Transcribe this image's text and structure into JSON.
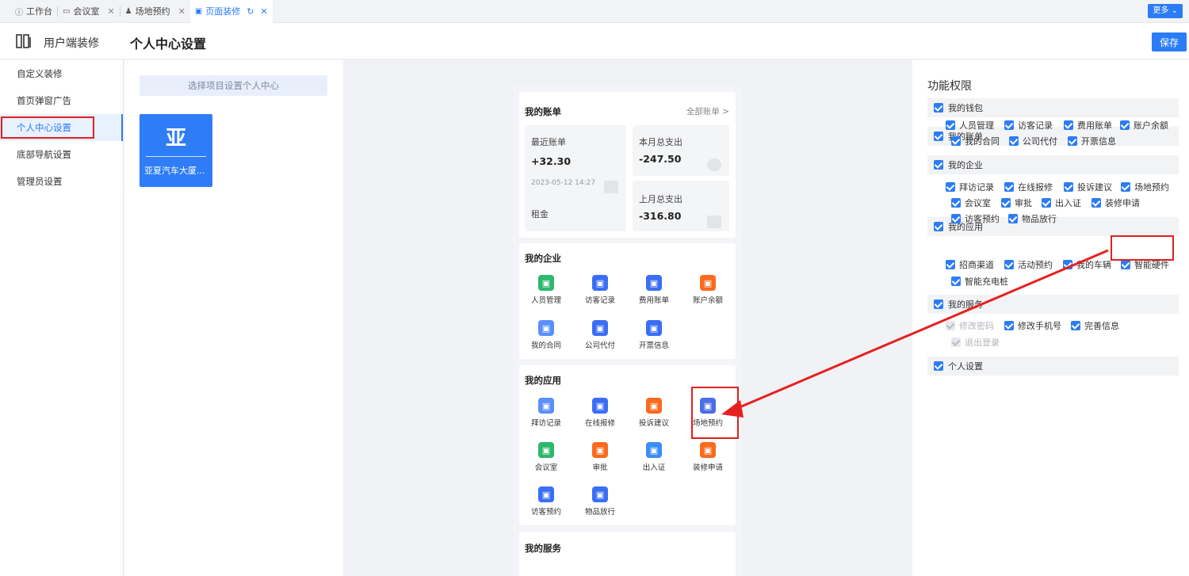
{
  "tabs": [
    {
      "label": "工作台",
      "icon": "info-circle-icon",
      "closable": false
    },
    {
      "label": "会议室",
      "icon": "monitor-icon",
      "closable": true
    },
    {
      "label": "场地预约",
      "icon": "user-icon",
      "closable": true
    },
    {
      "label": "页面装修",
      "icon": "page-icon",
      "closable": true,
      "active": true
    }
  ],
  "more_label": "更多",
  "header": {
    "app_title": "用户端装修",
    "page_title": "个人中心设置",
    "save_label": "保存"
  },
  "sidebar": {
    "items": [
      {
        "label": "自定义装修"
      },
      {
        "label": "首页弹窗广告"
      },
      {
        "label": "个人中心设置",
        "active": true
      },
      {
        "label": "底部导航设置"
      },
      {
        "label": "管理员设置"
      }
    ]
  },
  "project": {
    "placeholder": "选择项目设置个人中心",
    "card_char": "亚",
    "card_name": "亚夏汽车大厦..."
  },
  "preview": {
    "bill": {
      "title": "我的账单",
      "all_label": "全部账单 >",
      "recent_label": "最近账单",
      "recent_amount": "+32.30",
      "recent_date": "2023-05-12 14:27",
      "recent_type": "租金",
      "month_label": "本月总支出",
      "month_amount": "-247.50",
      "last_month_label": "上月总支出",
      "last_month_amount": "-316.80"
    },
    "enterprise": {
      "title": "我的企业",
      "items": [
        {
          "label": "人员管理",
          "color": "#2db86c",
          "icon": "people-icon"
        },
        {
          "label": "访客记录",
          "color": "#3b6ef5",
          "icon": "visitor-icon"
        },
        {
          "label": "费用账单",
          "color": "#3b6ef5",
          "icon": "bill-icon"
        },
        {
          "label": "账户余额",
          "color": "#fa6b1e",
          "icon": "wallet-icon"
        },
        {
          "label": "我的合同",
          "color": "#5b8ff9",
          "icon": "contract-icon"
        },
        {
          "label": "公司代付",
          "color": "#3b6ef5",
          "icon": "pay-icon"
        },
        {
          "label": "开票信息",
          "color": "#3b6ef5",
          "icon": "invoice-icon"
        }
      ]
    },
    "apps": {
      "title": "我的应用",
      "items": [
        {
          "label": "拜访记录",
          "color": "#5b8ff9",
          "icon": "record-icon"
        },
        {
          "label": "在线报修",
          "color": "#3b6ef5",
          "icon": "repair-icon"
        },
        {
          "label": "投诉建议",
          "color": "#fa6b1e",
          "icon": "complaint-icon"
        },
        {
          "label": "场地预约",
          "color": "#4b6de8",
          "icon": "venue-icon"
        },
        {
          "label": "会议室",
          "color": "#2db86c",
          "icon": "meeting-icon"
        },
        {
          "label": "审批",
          "color": "#fa6b1e",
          "icon": "approval-icon"
        },
        {
          "label": "出入证",
          "color": "#3b8ef5",
          "icon": "pass-icon"
        },
        {
          "label": "装修申请",
          "color": "#fa6b1e",
          "icon": "decor-icon"
        },
        {
          "label": "访客预约",
          "color": "#3b6ef5",
          "icon": "visitor-booking-icon"
        },
        {
          "label": "物品放行",
          "color": "#3b6ef5",
          "icon": "goods-icon"
        }
      ]
    },
    "services": {
      "title": "我的服务"
    }
  },
  "permissions": {
    "title": "功能权限",
    "sections": [
      {
        "label": "我的钱包",
        "options": []
      },
      {
        "label": "我的账单",
        "options": []
      },
      {
        "label": "我的企业",
        "options": [
          "人员管理",
          "访客记录",
          "费用账单",
          "账户余额",
          "我的合同",
          "公司代付",
          "开票信息"
        ]
      },
      {
        "label": "我的应用",
        "options": [
          "拜访记录",
          "在线报修",
          "投诉建议",
          "场地预约",
          "会议室",
          "审批",
          "出入证",
          "装修申请",
          "访客预约",
          "物品放行"
        ]
      },
      {
        "label": "我的服务",
        "options": [
          "招商渠道",
          "活动预约",
          "我的车辆",
          "智能硬件",
          "智能充电桩"
        ]
      },
      {
        "label": "个人设置",
        "options": [
          "修改密码",
          "修改手机号",
          "完善信息",
          "退出登录"
        ]
      }
    ]
  }
}
